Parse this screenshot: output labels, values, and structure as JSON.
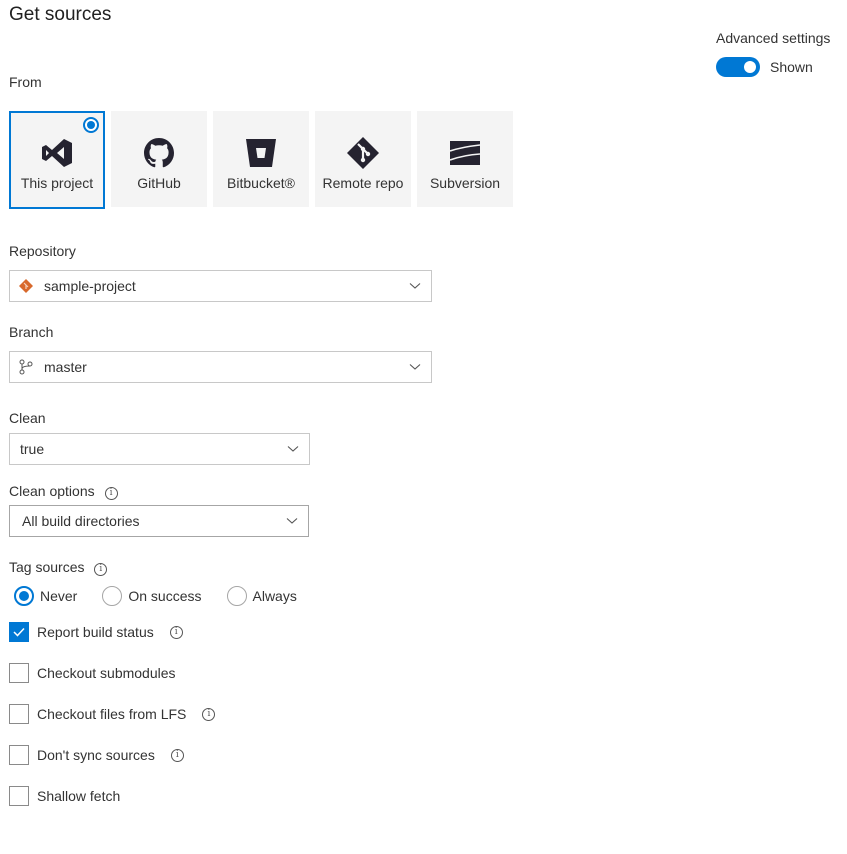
{
  "header": {
    "title": "Get sources"
  },
  "advanced_settings": {
    "label": "Advanced settings",
    "toggle_on": true,
    "toggle_text": "Shown",
    "accent": "#0078d4"
  },
  "from": {
    "label": "From",
    "sources": [
      {
        "label": "This project",
        "icon": "visual-studio-icon",
        "selected": true
      },
      {
        "label": "GitHub",
        "icon": "github-icon",
        "selected": false
      },
      {
        "label": "Bitbucket®",
        "icon": "bitbucket-icon",
        "selected": false
      },
      {
        "label": "Remote repo",
        "icon": "git-icon",
        "selected": false
      },
      {
        "label": "Subversion",
        "icon": "subversion-icon",
        "selected": false
      }
    ]
  },
  "repository": {
    "label": "Repository",
    "value": "sample-project",
    "icon": "git-repo-icon",
    "icon_color": "#d8692c"
  },
  "branch": {
    "label": "Branch",
    "value": "master",
    "icon": "branch-icon"
  },
  "clean": {
    "label": "Clean",
    "value": "true"
  },
  "clean_options": {
    "label": "Clean options",
    "value": "All build directories",
    "info": "i"
  },
  "tag_sources": {
    "label": "Tag sources",
    "info": "i",
    "options": [
      {
        "label": "Never",
        "selected": true
      },
      {
        "label": "On success",
        "selected": false
      },
      {
        "label": "Always",
        "selected": false
      }
    ]
  },
  "checkboxes": [
    {
      "label": "Report build status",
      "checked": true,
      "info": true
    },
    {
      "label": "Checkout submodules",
      "checked": false,
      "info": false
    },
    {
      "label": "Checkout files from LFS",
      "checked": false,
      "info": true
    },
    {
      "label": "Don't sync sources",
      "checked": false,
      "info": true
    },
    {
      "label": "Shallow fetch",
      "checked": false,
      "info": false
    }
  ],
  "info_glyph": "i"
}
